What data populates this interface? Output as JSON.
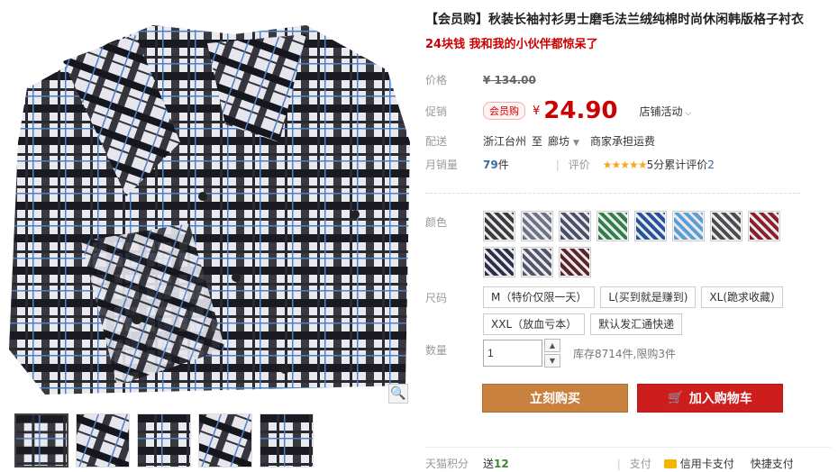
{
  "product": {
    "title": "【会员购】秋装长袖衬衫男士磨毛法兰绒纯棉时尚休闲韩版格子衬衣",
    "subtitle": "24块钱 我和我的小伙伴都惊呆了"
  },
  "price": {
    "label": "价格",
    "currency": "¥",
    "original": "134.00"
  },
  "promo": {
    "label": "促销",
    "tag": "会员购",
    "currency": "¥",
    "price": "24.90",
    "store_activity": "店铺活动"
  },
  "shipping": {
    "label": "配送",
    "from": "浙江台州",
    "to_word": "至",
    "dest": "廊坊",
    "note": "商家承担运费"
  },
  "sales": {
    "label": "月销量",
    "count": "79",
    "unit": "件",
    "review_label": "评价",
    "stars": "★★★★★",
    "score": "5分",
    "review_count_label": "累计评价",
    "review_count": "2"
  },
  "color": {
    "label": "颜色",
    "swatch_colors": [
      "#3b3b3b",
      "#6d7285",
      "#4b4f67",
      "#2f7f46",
      "#27539a",
      "#5a9ed2",
      "#4c4c4c",
      "#8a1f2a",
      "#2c2f48",
      "#525668",
      "#5c2424"
    ]
  },
  "size": {
    "label": "尺码",
    "options": [
      "M（特价仅限一天）",
      "L(买到就是赚到)",
      "XL(跪求收藏)",
      "XXL（放血亏本）",
      "默认发汇通快递"
    ]
  },
  "quantity": {
    "label": "数量",
    "value": "1",
    "up": "▲",
    "down": "▼",
    "stock": "库存8714件,限购3件"
  },
  "actions": {
    "buy_now": "立刻购买",
    "add_cart": "加入购物车"
  },
  "bottom": {
    "points_label": "天猫积分",
    "points_prefix": "送",
    "points_value": "12",
    "pay_label": "支付",
    "pay_card": "信用卡支付",
    "pay_fast": "快捷支付"
  },
  "colors": {
    "accent": "#c00000",
    "buy_button": "#c8813e",
    "cart_button": "#cd1d1d"
  }
}
